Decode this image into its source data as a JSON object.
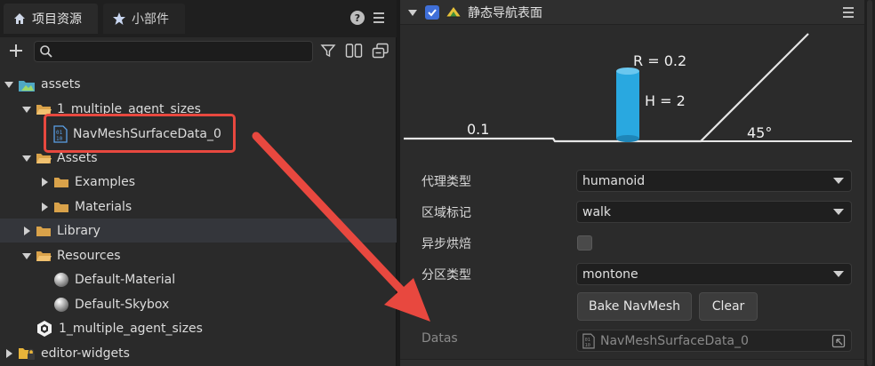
{
  "left_panel": {
    "tabs": [
      {
        "label": "项目资源",
        "icon": "home-icon"
      },
      {
        "label": "小部件",
        "icon": "star-icon"
      }
    ],
    "search": {
      "placeholder": "",
      "value": ""
    },
    "tree": [
      {
        "label": "assets",
        "icon": "assets-folder-icon",
        "expanded": true
      },
      {
        "label": "1_multiple_agent_sizes",
        "icon": "folder-icon",
        "expanded": true
      },
      {
        "label": "NavMeshSurfaceData_0",
        "icon": "binary-file-icon"
      },
      {
        "label": "Assets",
        "icon": "folder-icon",
        "expanded": true
      },
      {
        "label": "Examples",
        "icon": "folder-icon",
        "expanded": false
      },
      {
        "label": "Materials",
        "icon": "folder-icon",
        "expanded": false
      },
      {
        "label": "Library",
        "icon": "folder-icon",
        "expanded": false
      },
      {
        "label": "Resources",
        "icon": "folder-icon",
        "expanded": true
      },
      {
        "label": "Default-Material",
        "icon": "material-sphere-icon"
      },
      {
        "label": "Default-Skybox",
        "icon": "material-sphere-icon"
      },
      {
        "label": "1_multiple_agent_sizes",
        "icon": "scene-icon"
      },
      {
        "label": "editor-widgets",
        "icon": "locked-folder-icon",
        "expanded": false
      }
    ]
  },
  "right_panel": {
    "component_title": "静态导航表面",
    "diagram": {
      "radius_label": "R = 0.2",
      "height_label": "H = 2",
      "step_label": "0.1",
      "slope_label": "45°"
    },
    "properties": {
      "agent_type_label": "代理类型",
      "agent_type_value": "humanoid",
      "area_label": "区域标记",
      "area_value": "walk",
      "async_bake_label": "异步烘焙",
      "partition_label": "分区类型",
      "partition_value": "montone",
      "bake_button": "Bake NavMesh",
      "clear_button": "Clear",
      "datas_label": "Datas",
      "datas_value": "NavMeshSurfaceData_0"
    }
  },
  "colors": {
    "accent": "#3f6fd8",
    "annotation_red": "#e8483f",
    "agent_cyan": "#29a8e0",
    "folder": "#d9a24a"
  }
}
